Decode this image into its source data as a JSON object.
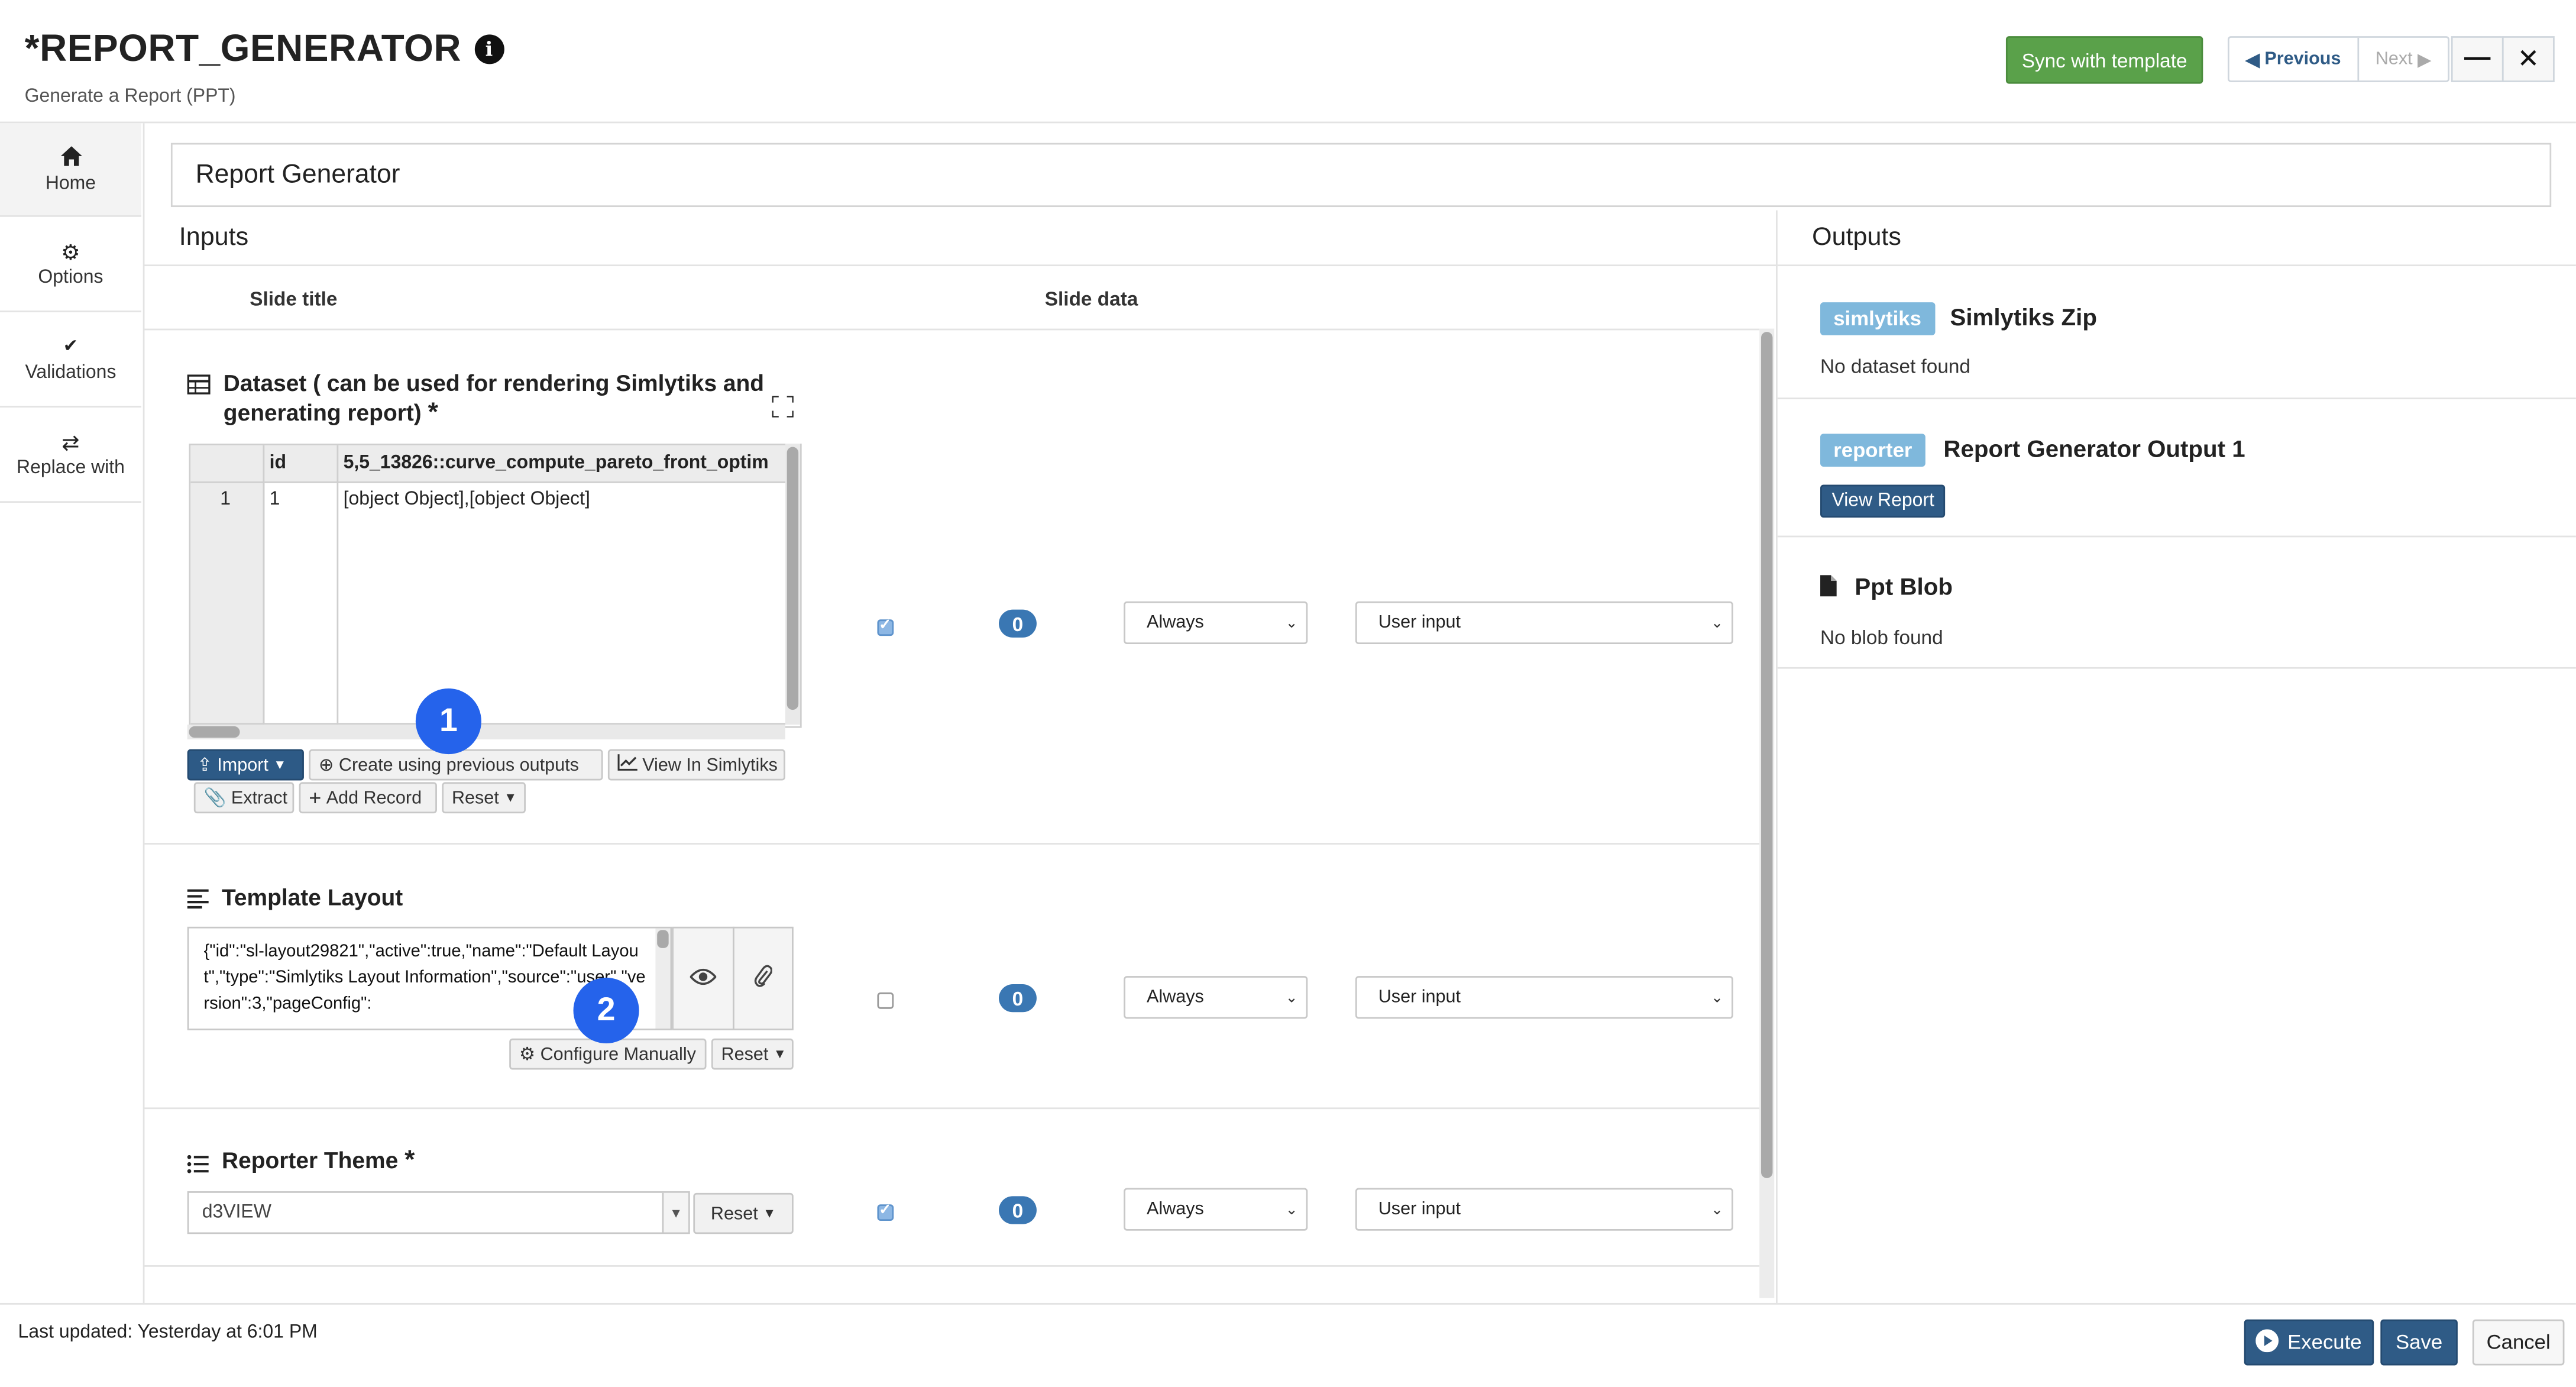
{
  "header": {
    "title": "*REPORT_GENERATOR",
    "subtitle": "Generate a Report (PPT)",
    "sync_button": "Sync with template",
    "previous": "Previous",
    "next": "Next",
    "minimize": "—",
    "close": "✕"
  },
  "sidebar": {
    "items": [
      {
        "label": "Home",
        "icon": "home-icon"
      },
      {
        "label": "Options",
        "icon": "gear-icon"
      },
      {
        "label": "Validations",
        "icon": "check-icon"
      },
      {
        "label": "Replace with",
        "icon": "swap-icon"
      }
    ]
  },
  "main": {
    "report_name": "Report Generator",
    "inputs_heading": "Inputs",
    "outputs_heading": "Outputs",
    "col_slide_title": "Slide title",
    "col_slide_data": "Slide data"
  },
  "dataset": {
    "title": "Dataset ( can be used for rendering Simlytiks and generating report)",
    "required": "*",
    "table": {
      "headers": [
        "id",
        "5,5_13826::curve_compute_pareto_front_optim"
      ],
      "rows": [
        [
          "1",
          "1",
          "[object Object],[object Object]"
        ]
      ]
    },
    "buttons": {
      "import": "Import",
      "create": "Create using previous outputs",
      "view": "View In Simlytiks",
      "extract": "Extract",
      "add_record": "Add Record",
      "reset": "Reset"
    },
    "checked": true,
    "count": "0",
    "condition": "Always",
    "source": "User input"
  },
  "template_layout": {
    "title": "Template Layout",
    "text": "{\"id\":\"sl-layout29821\",\"active\":true,\"name\":\"Default Layout\",\"type\":\"Simlytiks Layout Information\",\"source\":\"user\",\"version\":3,\"pageConfig\":",
    "buttons": {
      "configure": "Configure Manually",
      "reset": "Reset"
    },
    "checked": false,
    "count": "0",
    "condition": "Always",
    "source": "User input"
  },
  "reporter_theme": {
    "title": "Reporter Theme",
    "required": "*",
    "value": "d3VIEW",
    "reset": "Reset",
    "checked": true,
    "count": "0",
    "condition": "Always",
    "source": "User input"
  },
  "markers": [
    "1",
    "2"
  ],
  "outputs": [
    {
      "tag": "simlytiks",
      "title": "Simlytiks Zip",
      "note": "No dataset found"
    },
    {
      "tag": "reporter",
      "title": "Report Generator Output 1",
      "action": "View Report"
    },
    {
      "icon": "file-icon",
      "title": "Ppt Blob",
      "note": "No blob found"
    }
  ],
  "footer": {
    "last_updated": "Last updated: Yesterday at 6:01 PM",
    "execute": "Execute",
    "save": "Save",
    "cancel": "Cancel"
  },
  "colors": {
    "sync_green": "#5aa14a",
    "primary_blue": "#2f5b86",
    "tag_blue": "#7fb8dc",
    "marker_blue": "#2563eb"
  }
}
